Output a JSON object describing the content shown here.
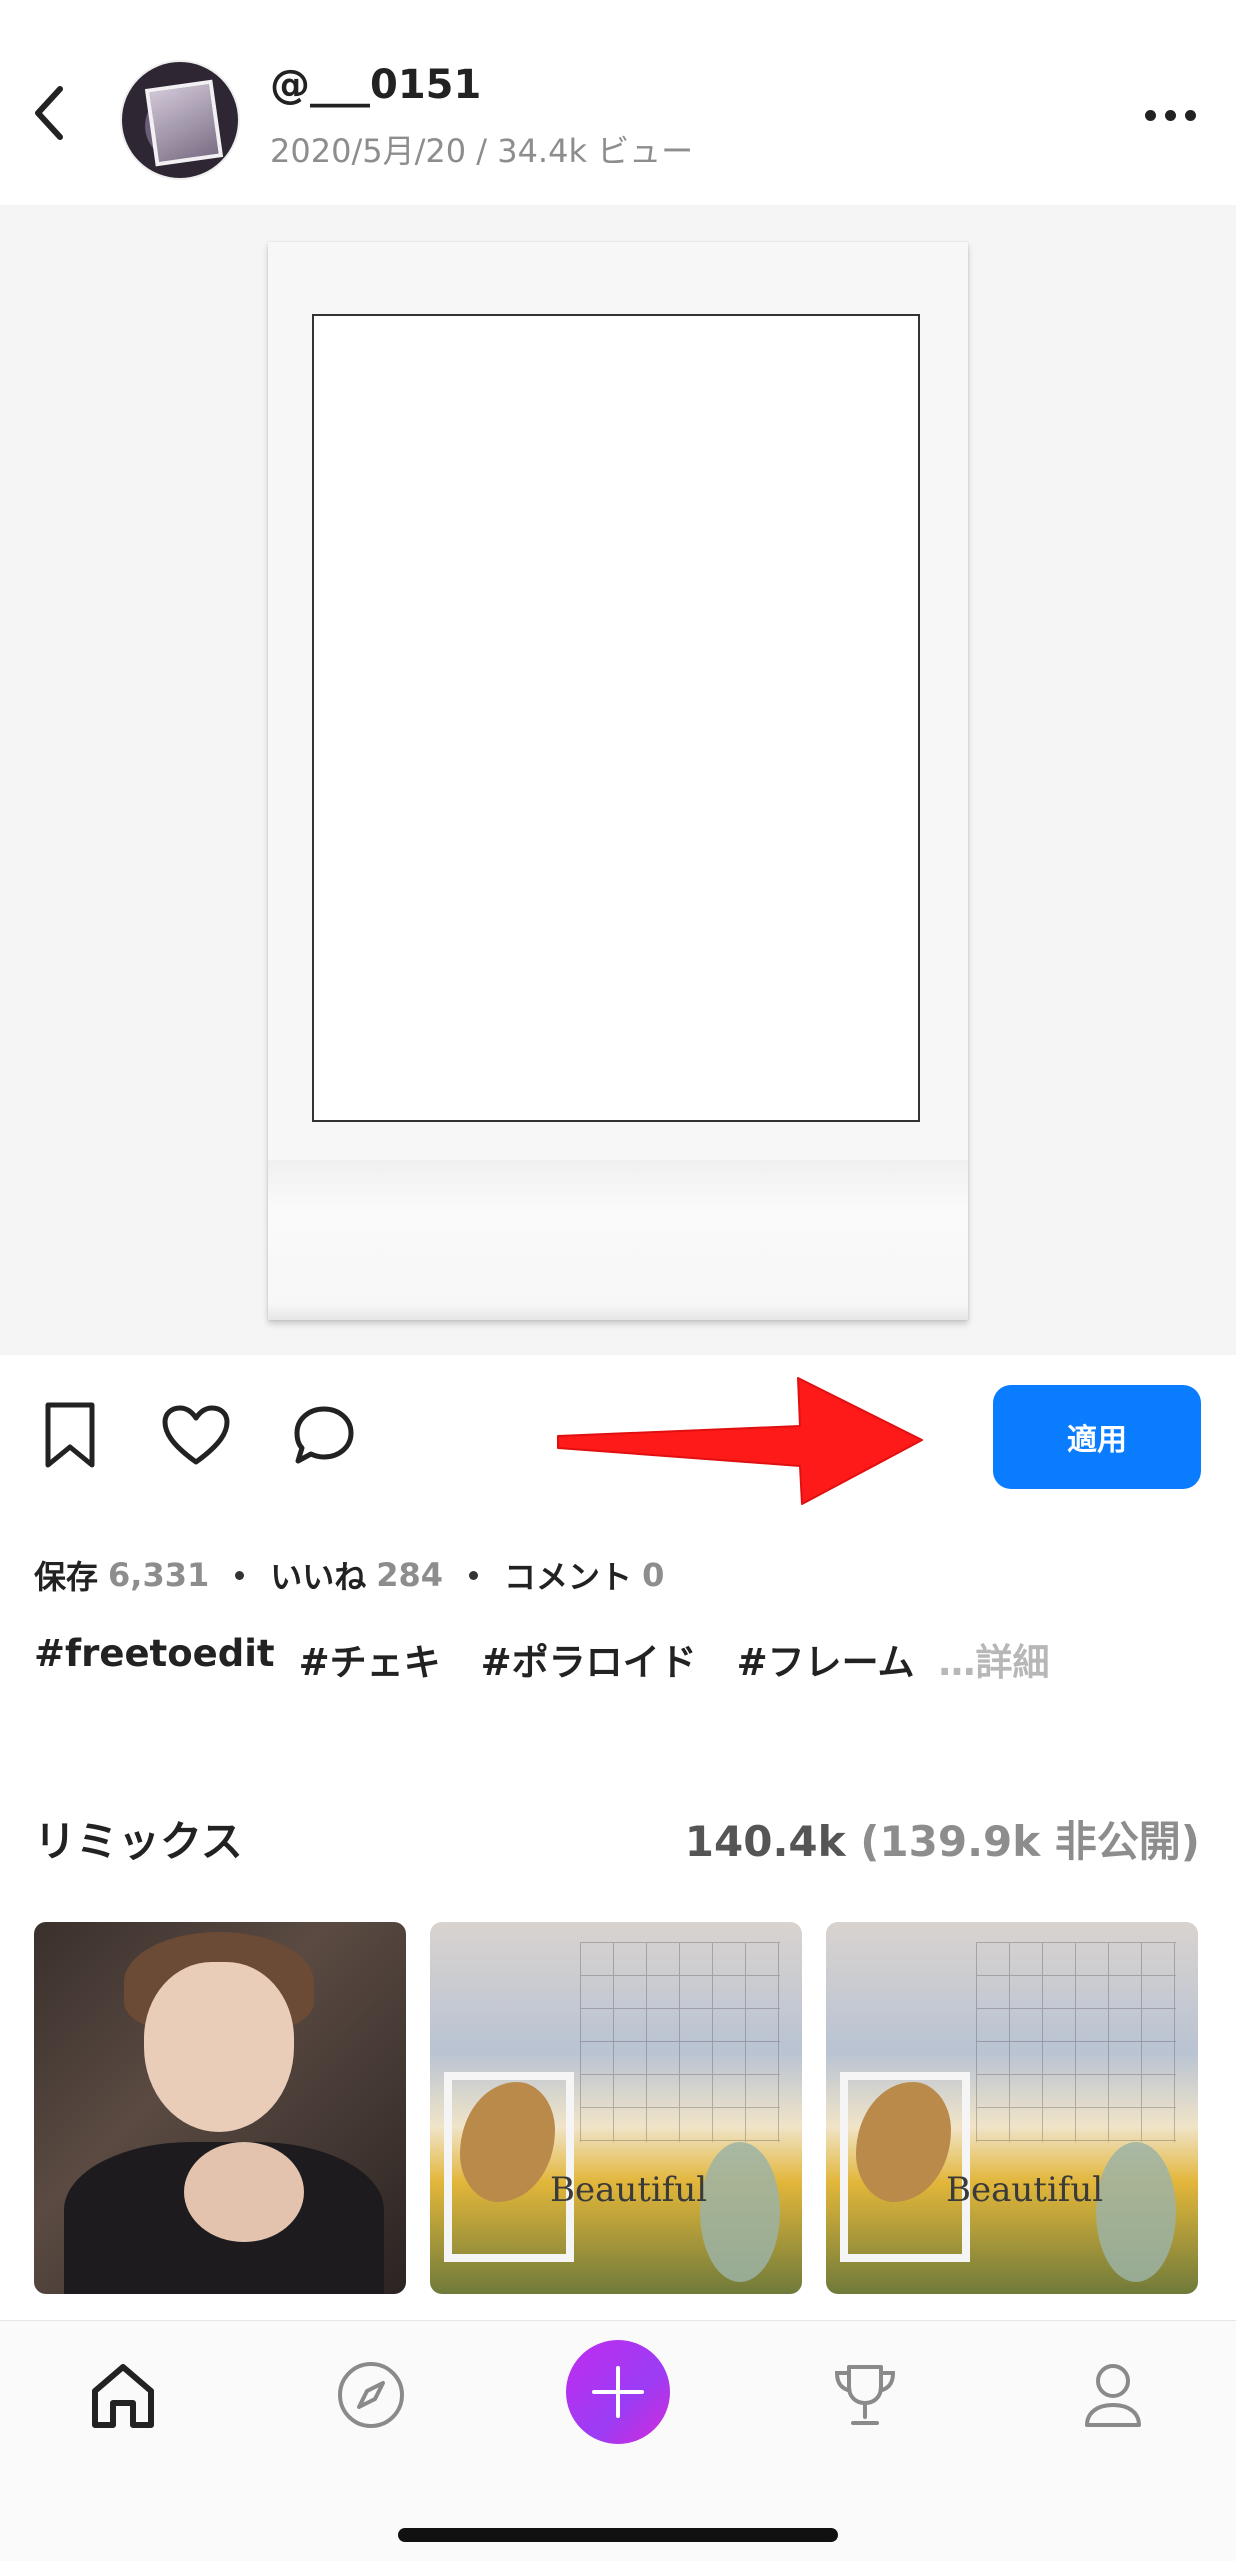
{
  "header": {
    "username": "@___0151",
    "meta": "2020/5月/20 / 34.4k ビュー"
  },
  "actions": {
    "apply_label": "適用"
  },
  "stats": {
    "saves_label": "保存",
    "saves_count": "6,331",
    "likes_label": "いいね",
    "likes_count": "284",
    "comments_label": "コメント",
    "comments_count": "0"
  },
  "tags": [
    "#freetoedit",
    "#チェキ",
    "#ポラロイド",
    "#フレーム"
  ],
  "tags_more": "…詳細",
  "remix": {
    "title": "リミックス",
    "count": "140.4k",
    "private": "(139.9k 非公開)",
    "thumb_text": "Beautiful"
  },
  "colors": {
    "accent": "#0a7cff",
    "create_button": "#c12cf0",
    "arrow": "#ff1a1a"
  },
  "icons": {
    "back": "chevron-left-icon",
    "more": "more-horizontal-icon",
    "bookmark": "bookmark-icon",
    "like": "heart-icon",
    "comment": "speech-bubble-icon",
    "home": "home-icon",
    "explore": "compass-icon",
    "create": "plus-icon",
    "challenges": "trophy-icon",
    "profile": "profile-icon"
  }
}
